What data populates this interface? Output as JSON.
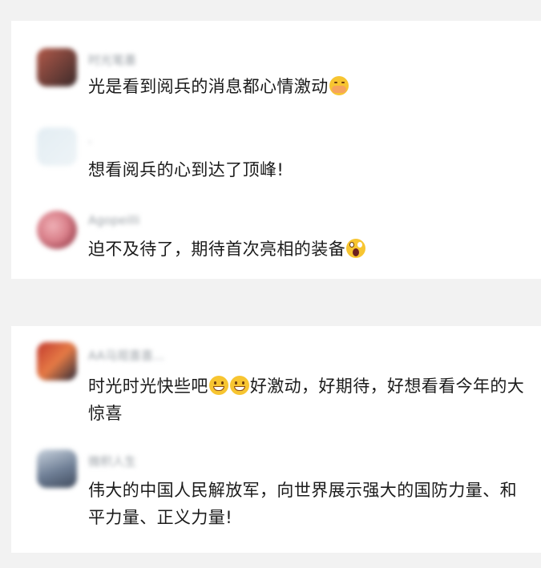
{
  "cards": [
    {
      "comments": [
        {
          "username": "时光笔墨",
          "avatar_colors": [
            "#b35a4a",
            "#3b2a2a"
          ],
          "text": "光是看到阅兵的消息都心情激动",
          "emoji": "shy-emoji-icon"
        },
        {
          "username": "·",
          "avatar_colors": [
            "#e3edf3",
            "#eef4f7"
          ],
          "text": "想看阅兵的心到达了顶峰!"
        },
        {
          "username": "Agopeilli",
          "avatar_colors": [
            "#d9808a",
            "#7a1f2f"
          ],
          "text": "迫不及待了，期待首次亮相的装备",
          "emoji": "astonished-emoji-icon"
        }
      ]
    },
    {
      "comments": [
        {
          "username": "AA马观喜喜...",
          "avatar_colors": [
            "#c23a2f",
            "#2b2b3a"
          ],
          "text_part1": "时光时光快些吧",
          "emoji": "grinning-emoji-icon",
          "text_part2": "好激动，好期待，好想看看今年的大惊喜"
        },
        {
          "username": "微积人生",
          "avatar_colors": [
            "#6f7f96",
            "#c9d3de"
          ],
          "text": "伟大的中国人民解放军，向世界展示强大的国防力量、和平力量、正义力量!"
        }
      ]
    }
  ]
}
